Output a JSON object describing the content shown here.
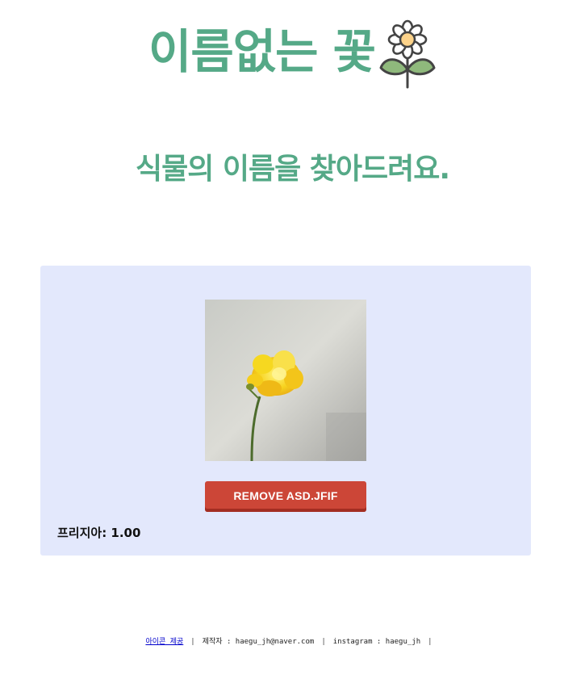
{
  "header": {
    "title": "이름없는 꽃"
  },
  "subtitle": "식물의 이름을 찾아드려요.",
  "upload": {
    "remove_label": "REMOVE ASD.JFIF"
  },
  "result": {
    "text": "프리지아: 1.00"
  },
  "footer": {
    "icon_credit": "아이콘 제공",
    "author": "제작자 : haegu_jh@naver.com",
    "instagram": "instagram : haegu_jh"
  },
  "colors": {
    "brand_green": "#55a987",
    "card_background": "#e3e8fc",
    "remove_button": "#cc4637"
  }
}
